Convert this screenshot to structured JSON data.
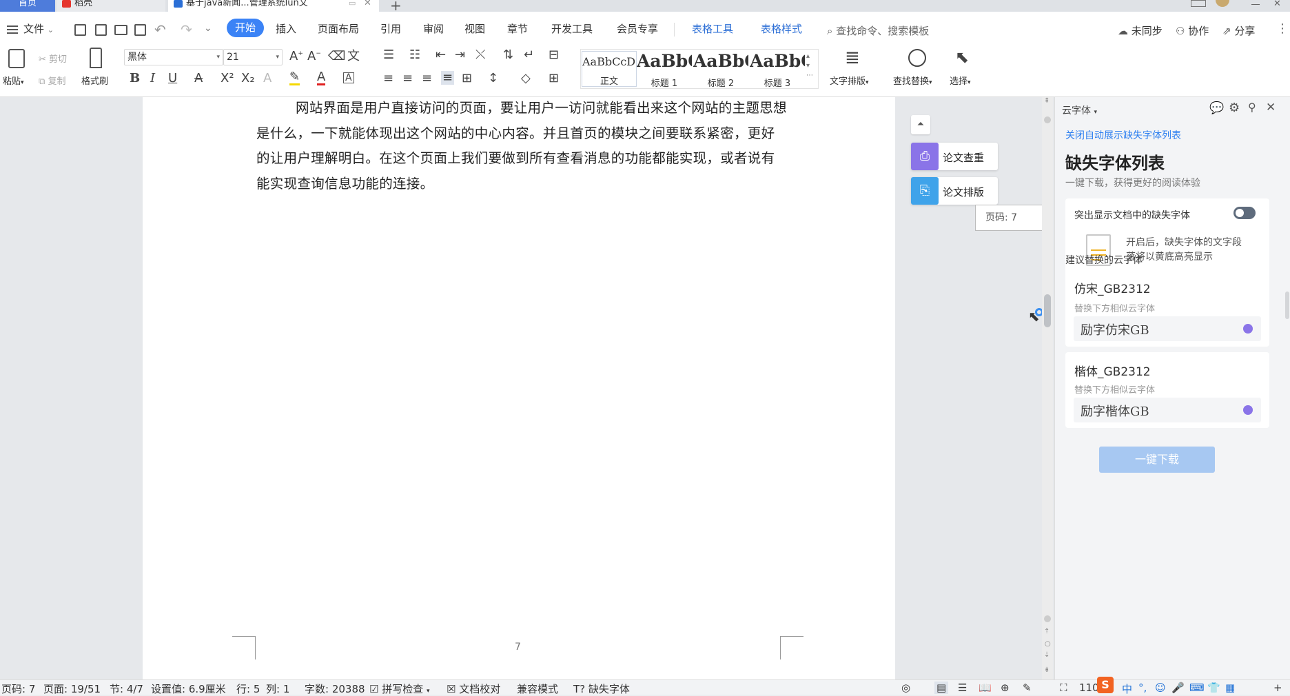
{
  "tabs": {
    "home": "首页",
    "daoke": "稻壳",
    "document": "基于java新闻...管理系统lun文",
    "new_tab": "+"
  },
  "menu": {
    "file": "文件",
    "items": [
      "开始",
      "插入",
      "页面布局",
      "引用",
      "审阅",
      "视图",
      "章节",
      "开发工具",
      "会员专享"
    ],
    "table_tools": "表格工具",
    "table_style": "表格样式",
    "search_placeholder": "查找命令、搜索模板",
    "unsynced": "未同步",
    "collab": "协作",
    "share": "分享"
  },
  "ribbon": {
    "paste": "粘贴",
    "cut": "剪切",
    "copy": "复制",
    "format_painter": "格式刷",
    "font_name": "黑体",
    "font_size": "21",
    "styles": [
      {
        "sample": "AaBbCcDd",
        "name": "正文"
      },
      {
        "sample": "AaBbC",
        "name": "标题 1"
      },
      {
        "sample": "AaBbC",
        "name": "标题 2"
      },
      {
        "sample": "AaBbC",
        "name": "标题 3"
      }
    ],
    "text_layout": "文字排版",
    "find_replace": "查找替换",
    "select": "选择"
  },
  "document": {
    "paragraph": "网站界面是用户直接访问的页面，要让用户一访问就能看出来这个网站的主题思想是什么，一下就能体现出这个网站的中心内容。并且首页的模块之间要联系紧密，更好的让用户理解明白。在这个页面上我们要做到所有查看消息的功能都能实现，或者说有能实现查询信息功能的连接。",
    "page_number": "7"
  },
  "side_tools": {
    "paper_check": "论文查重",
    "paper_format": "论文排版",
    "page_tooltip": "页码: 7"
  },
  "pane": {
    "header": "云字体",
    "link": "关闭自动展示缺失字体列表",
    "title": "缺失字体列表",
    "subtitle": "一键下载，获得更好的阅读体验",
    "highlight_label": "突出显示文档中的缺失字体",
    "highlight_on": false,
    "highlight_desc": "开启后，缺失字体的文字段落将以黄底高亮显示",
    "suggest_label": "建议替换的云字体",
    "fonts": [
      {
        "name": "仿宋_GB2312",
        "hint": "替换下方相似云字体",
        "replacement": "励字仿宋GB"
      },
      {
        "name": "楷体_GB2312",
        "hint": "替换下方相似云字体",
        "replacement": "励字楷体GB"
      }
    ],
    "download_button": "一键下载"
  },
  "status": {
    "page": "页码: 7",
    "pages": "页面: 19/51",
    "section": "节: 4/7",
    "setting": "设置值: 6.9厘米",
    "row": "行: 5",
    "col": "列: 1",
    "words": "字数: 20388",
    "spell": "拼写检查",
    "proof": "文档校对",
    "compat": "兼容模式",
    "missing_font": "缺失字体",
    "zoom": "110",
    "ime": "中"
  },
  "colors": {
    "accent": "#4e7cdb",
    "tab_active_pill": "#3b83f6",
    "download_btn": "#a7c8f2",
    "paper_check_icon": "#8a74e8",
    "paper_format_icon": "#3fa3ea"
  }
}
